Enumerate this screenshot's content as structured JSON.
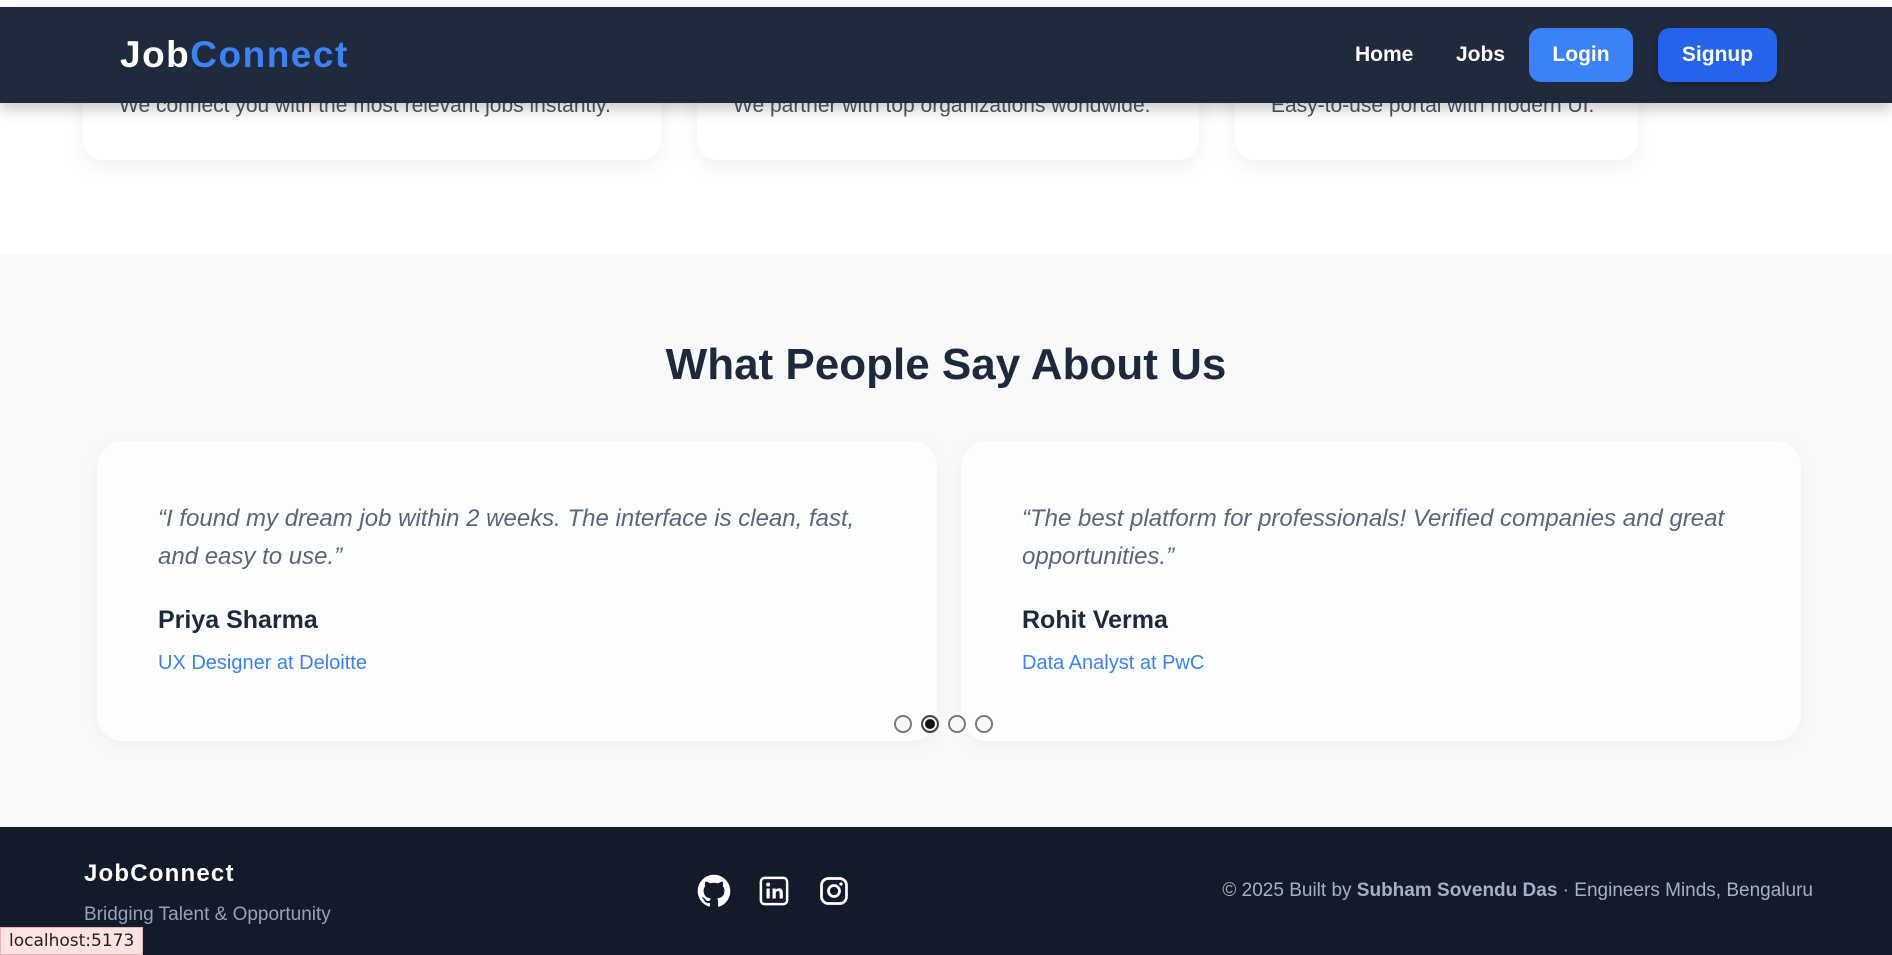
{
  "navbar": {
    "logo_part1": "Job",
    "logo_part2": "Connect",
    "links": [
      "Home",
      "Jobs"
    ],
    "login_label": "Login",
    "signup_label": "Signup"
  },
  "features": [
    {
      "description": "We connect you with the most relevant jobs instantly."
    },
    {
      "description": "We partner with top organizations worldwide."
    },
    {
      "description": "Easy-to-use portal with modern UI."
    }
  ],
  "testimonials": {
    "title": "What People Say About Us",
    "items": [
      {
        "quote": "“I found my dream job within 2 weeks. The interface is clean, fast, and easy to use.”",
        "name": "Priya Sharma",
        "role": "UX Designer at Deloitte"
      },
      {
        "quote": "“The best platform for professionals! Verified companies and great opportunities.”",
        "name": "Rohit Verma",
        "role": "Data Analyst at PwC"
      }
    ],
    "carousel": {
      "count": 4,
      "active_index": 1
    }
  },
  "footer": {
    "brand": "JobConnect",
    "tagline": "Bridging Talent & Opportunity",
    "social_icons": [
      "github-icon",
      "linkedin-icon",
      "instagram-icon"
    ],
    "credit_prefix": "© 2025 Built by ",
    "credit_name": "Subham Sovendu Das",
    "credit_suffix": " · Engineers Minds, Bengaluru"
  },
  "status_bar": {
    "url": "localhost:5173"
  },
  "colors": {
    "navbar_bg": "#1f2a3c",
    "accent": "#3b82f6",
    "signup_bg": "#2563eb",
    "footer_bg": "#131b2b"
  }
}
